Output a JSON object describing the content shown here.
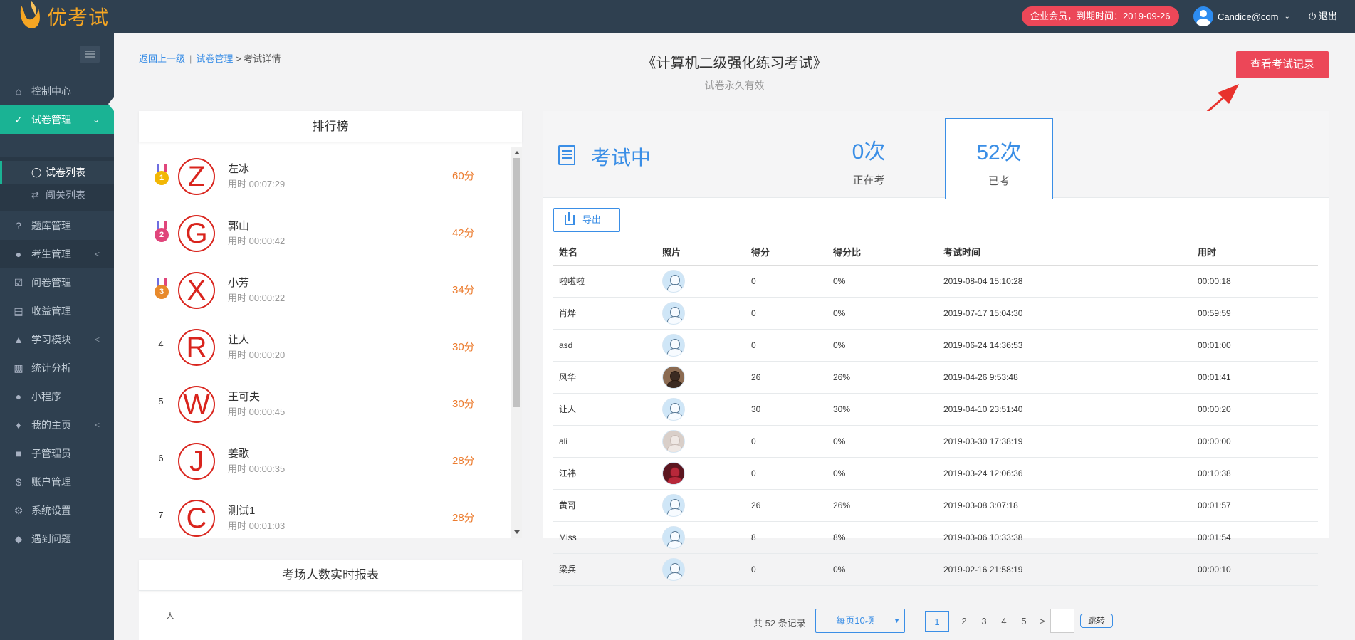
{
  "header": {
    "logo_text": "优考试",
    "member_badge": "企业会员，到期时间：2019-09-26",
    "username": "Candice@com",
    "logout_label": "退出"
  },
  "sidebar": {
    "items": [
      {
        "label": "控制中心",
        "icon": "home-icon"
      },
      {
        "label": "试卷管理",
        "icon": "check-circle-icon",
        "active": true
      },
      {
        "label": "题库管理",
        "icon": "question-icon"
      },
      {
        "label": "考生管理",
        "icon": "user-icon"
      },
      {
        "label": "问卷管理",
        "icon": "checkbox-icon"
      },
      {
        "label": "收益管理",
        "icon": "card-icon"
      },
      {
        "label": "学习模块",
        "icon": "graduation-icon"
      },
      {
        "label": "统计分析",
        "icon": "bar-chart-icon"
      },
      {
        "label": "小程序",
        "icon": "wechat-icon"
      },
      {
        "label": "我的主页",
        "icon": "puzzle-icon"
      },
      {
        "label": "子管理员",
        "icon": "lock-icon"
      },
      {
        "label": "账户管理",
        "icon": "dollar-icon"
      },
      {
        "label": "系统设置",
        "icon": "gear-icon"
      },
      {
        "label": "遇到问题",
        "icon": "tag-icon"
      }
    ],
    "sub_items": [
      {
        "label": "试卷列表",
        "active": true
      },
      {
        "label": "闯关列表"
      }
    ]
  },
  "breadcrumb": {
    "back": "返回上一级",
    "divider": "|",
    "parent": "试卷管理",
    "arrow": ">",
    "current": "考试详情"
  },
  "exam": {
    "title": "《计算机二级强化练习考试》",
    "validity": "试卷永久有效",
    "records_button": "查看考试记录"
  },
  "ranking": {
    "title": "排行榜",
    "rows": [
      {
        "rank": "1",
        "letter": "Z",
        "name": "左冰",
        "time": "用时 00:07:29",
        "score": "60分"
      },
      {
        "rank": "2",
        "letter": "G",
        "name": "郭山",
        "time": "用时 00:00:42",
        "score": "42分"
      },
      {
        "rank": "3",
        "letter": "X",
        "name": "小芳",
        "time": "用时 00:00:22",
        "score": "34分"
      },
      {
        "rank": "4",
        "letter": "R",
        "name": "让人",
        "time": "用时 00:00:20",
        "score": "30分"
      },
      {
        "rank": "5",
        "letter": "W",
        "name": "王可夫",
        "time": "用时 00:00:45",
        "score": "30分"
      },
      {
        "rank": "6",
        "letter": "J",
        "name": "姜歌",
        "time": "用时 00:00:35",
        "score": "28分"
      },
      {
        "rank": "7",
        "letter": "C",
        "name": "测试1",
        "time": "用时 00:01:03",
        "score": "28分"
      }
    ]
  },
  "report": {
    "title": "考场人数实时报表",
    "y_unit": "人"
  },
  "stats": {
    "status": "考试中",
    "in_progress_count": "0次",
    "in_progress_label": "正在考",
    "done_count": "52次",
    "done_label": "已考"
  },
  "records": {
    "export_label": "导出",
    "columns": [
      "姓名",
      "照片",
      "得分",
      "得分比",
      "考试时间",
      "用时"
    ],
    "rows": [
      {
        "name": "啦啦啦",
        "photo": "default",
        "score": "0",
        "ratio": "0%",
        "date": "2019-08-04 15:10:28",
        "duration": "00:00:18"
      },
      {
        "name": "肖烨",
        "photo": "default",
        "score": "0",
        "ratio": "0%",
        "date": "2019-07-17 15:04:30",
        "duration": "00:59:59"
      },
      {
        "name": "asd",
        "photo": "default",
        "score": "0",
        "ratio": "0%",
        "date": "2019-06-24 14:36:53",
        "duration": "00:01:00"
      },
      {
        "name": "风华",
        "photo": "brown",
        "score": "26",
        "ratio": "26%",
        "date": "2019-04-26 9:53:48",
        "duration": "00:01:41"
      },
      {
        "name": "让人",
        "photo": "default",
        "score": "30",
        "ratio": "30%",
        "date": "2019-04-10 23:51:40",
        "duration": "00:00:20"
      },
      {
        "name": "ali",
        "photo": "pale",
        "score": "0",
        "ratio": "0%",
        "date": "2019-03-30 17:38:19",
        "duration": "00:00:00"
      },
      {
        "name": "江祎",
        "photo": "red",
        "score": "0",
        "ratio": "0%",
        "date": "2019-03-24 12:06:36",
        "duration": "00:10:38"
      },
      {
        "name": "黄哥",
        "photo": "default",
        "score": "26",
        "ratio": "26%",
        "date": "2019-03-08 3:07:18",
        "duration": "00:01:57"
      },
      {
        "name": "Miss",
        "photo": "default",
        "score": "8",
        "ratio": "8%",
        "date": "2019-03-06 10:33:38",
        "duration": "00:01:54"
      },
      {
        "name": "梁兵",
        "photo": "default",
        "score": "0",
        "ratio": "0%",
        "date": "2019-02-16 21:58:19",
        "duration": "00:00:10"
      }
    ]
  },
  "pagination": {
    "total": "共 52 条记录",
    "per_page": "每页10项",
    "pages": [
      "1",
      "2",
      "3",
      "4",
      "5"
    ],
    "current": "1",
    "next": ">",
    "jump": "跳转"
  },
  "colors": {
    "sidebar_bg": "#2f4050",
    "active_green": "#1ab394",
    "accent_blue": "#3a8ee6",
    "danger_red": "#ec4758",
    "score_orange": "#ec7c2f"
  }
}
